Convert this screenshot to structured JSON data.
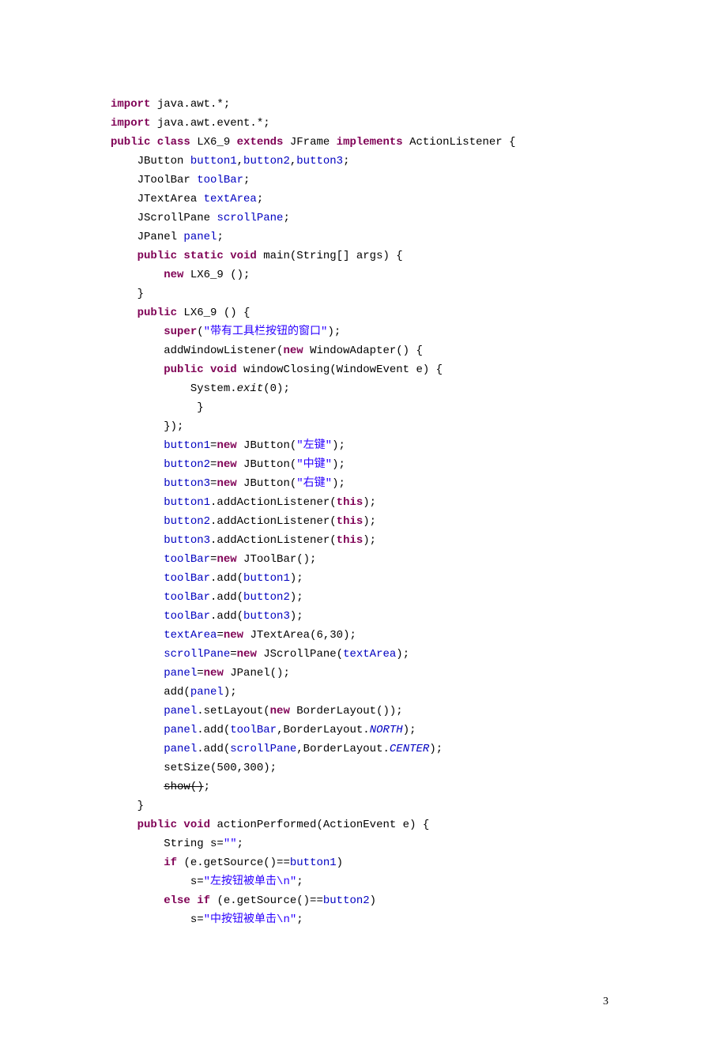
{
  "page_number": "3",
  "lines": [
    {
      "indent": 0,
      "tokens": [
        {
          "t": "import ",
          "c": "kw"
        },
        {
          "t": "java.awt.*;"
        }
      ]
    },
    {
      "indent": 0,
      "tokens": [
        {
          "t": "import ",
          "c": "kw"
        },
        {
          "t": "java.awt.event.*;"
        }
      ]
    },
    {
      "indent": 0,
      "tokens": [
        {
          "t": "public class ",
          "c": "kw"
        },
        {
          "t": "LX6_9 "
        },
        {
          "t": "extends ",
          "c": "kw"
        },
        {
          "t": "JFrame "
        },
        {
          "t": "implements ",
          "c": "kw"
        },
        {
          "t": "ActionListener {"
        }
      ]
    },
    {
      "indent": 1,
      "tokens": [
        {
          "t": "JButton "
        },
        {
          "t": "button1",
          "c": "fld"
        },
        {
          "t": ","
        },
        {
          "t": "button2",
          "c": "fld"
        },
        {
          "t": ","
        },
        {
          "t": "button3",
          "c": "fld"
        },
        {
          "t": ";"
        }
      ]
    },
    {
      "indent": 1,
      "tokens": [
        {
          "t": "JToolBar "
        },
        {
          "t": "toolBar",
          "c": "fld"
        },
        {
          "t": ";"
        }
      ]
    },
    {
      "indent": 1,
      "tokens": [
        {
          "t": "JTextArea "
        },
        {
          "t": "textArea",
          "c": "fld"
        },
        {
          "t": ";"
        }
      ]
    },
    {
      "indent": 1,
      "tokens": [
        {
          "t": "JScrollPane "
        },
        {
          "t": "scrollPane",
          "c": "fld"
        },
        {
          "t": ";"
        }
      ]
    },
    {
      "indent": 1,
      "tokens": [
        {
          "t": "JPanel "
        },
        {
          "t": "panel",
          "c": "fld"
        },
        {
          "t": ";"
        }
      ]
    },
    {
      "indent": 1,
      "tokens": [
        {
          "t": "public static void ",
          "c": "kw"
        },
        {
          "t": "main(String[] args) {"
        }
      ]
    },
    {
      "indent": 2,
      "tokens": [
        {
          "t": "new ",
          "c": "kw"
        },
        {
          "t": "LX6_9 ();"
        }
      ]
    },
    {
      "indent": 1,
      "tokens": [
        {
          "t": "}"
        }
      ]
    },
    {
      "indent": 1,
      "tokens": [
        {
          "t": "public ",
          "c": "kw"
        },
        {
          "t": "LX6_9 () {"
        }
      ]
    },
    {
      "indent": 2,
      "tokens": [
        {
          "t": "super",
          "c": "kw"
        },
        {
          "t": "("
        },
        {
          "t": "\"带有工具栏按钮的窗口\"",
          "c": "str"
        },
        {
          "t": ");"
        }
      ]
    },
    {
      "indent": 2,
      "tokens": [
        {
          "t": "addWindowListener("
        },
        {
          "t": "new ",
          "c": "kw"
        },
        {
          "t": "WindowAdapter() {"
        }
      ]
    },
    {
      "indent": 2,
      "tokens": [
        {
          "t": "public void ",
          "c": "kw"
        },
        {
          "t": "windowClosing(WindowEvent e) {"
        }
      ]
    },
    {
      "indent": 3,
      "tokens": [
        {
          "t": "System."
        },
        {
          "t": "exit",
          "c": "sta"
        },
        {
          "t": "(0);"
        }
      ]
    },
    {
      "indent": 3,
      "tokens": [
        {
          "t": " }"
        }
      ]
    },
    {
      "indent": 2,
      "tokens": [
        {
          "t": "});"
        }
      ]
    },
    {
      "indent": 2,
      "tokens": [
        {
          "t": "button1",
          "c": "fld"
        },
        {
          "t": "="
        },
        {
          "t": "new ",
          "c": "kw"
        },
        {
          "t": "JButton("
        },
        {
          "t": "\"左键\"",
          "c": "str"
        },
        {
          "t": ");"
        }
      ]
    },
    {
      "indent": 2,
      "tokens": [
        {
          "t": "button2",
          "c": "fld"
        },
        {
          "t": "="
        },
        {
          "t": "new ",
          "c": "kw"
        },
        {
          "t": "JButton("
        },
        {
          "t": "\"中键\"",
          "c": "str"
        },
        {
          "t": ");"
        }
      ]
    },
    {
      "indent": 2,
      "tokens": [
        {
          "t": "button3",
          "c": "fld"
        },
        {
          "t": "="
        },
        {
          "t": "new ",
          "c": "kw"
        },
        {
          "t": "JButton("
        },
        {
          "t": "\"右键\"",
          "c": "str"
        },
        {
          "t": ");"
        }
      ]
    },
    {
      "indent": 2,
      "tokens": [
        {
          "t": "button1",
          "c": "fld"
        },
        {
          "t": ".addActionListener("
        },
        {
          "t": "this",
          "c": "kw"
        },
        {
          "t": ");"
        }
      ]
    },
    {
      "indent": 2,
      "tokens": [
        {
          "t": "button2",
          "c": "fld"
        },
        {
          "t": ".addActionListener("
        },
        {
          "t": "this",
          "c": "kw"
        },
        {
          "t": ");"
        }
      ]
    },
    {
      "indent": 2,
      "tokens": [
        {
          "t": "button3",
          "c": "fld"
        },
        {
          "t": ".addActionListener("
        },
        {
          "t": "this",
          "c": "kw"
        },
        {
          "t": ");"
        }
      ]
    },
    {
      "indent": 2,
      "tokens": [
        {
          "t": "toolBar",
          "c": "fld"
        },
        {
          "t": "="
        },
        {
          "t": "new ",
          "c": "kw"
        },
        {
          "t": "JToolBar();"
        }
      ]
    },
    {
      "indent": 2,
      "tokens": [
        {
          "t": "toolBar",
          "c": "fld"
        },
        {
          "t": ".add("
        },
        {
          "t": "button1",
          "c": "fld"
        },
        {
          "t": ");"
        }
      ]
    },
    {
      "indent": 2,
      "tokens": [
        {
          "t": "toolBar",
          "c": "fld"
        },
        {
          "t": ".add("
        },
        {
          "t": "button2",
          "c": "fld"
        },
        {
          "t": ");"
        }
      ]
    },
    {
      "indent": 2,
      "tokens": [
        {
          "t": "toolBar",
          "c": "fld"
        },
        {
          "t": ".add("
        },
        {
          "t": "button3",
          "c": "fld"
        },
        {
          "t": ");"
        }
      ]
    },
    {
      "indent": 2,
      "tokens": [
        {
          "t": "textArea",
          "c": "fld"
        },
        {
          "t": "="
        },
        {
          "t": "new ",
          "c": "kw"
        },
        {
          "t": "JTextArea(6,30);"
        }
      ]
    },
    {
      "indent": 2,
      "tokens": [
        {
          "t": "scrollPane",
          "c": "fld"
        },
        {
          "t": "="
        },
        {
          "t": "new ",
          "c": "kw"
        },
        {
          "t": "JScrollPane("
        },
        {
          "t": "textArea",
          "c": "fld"
        },
        {
          "t": ");"
        }
      ]
    },
    {
      "indent": 2,
      "tokens": [
        {
          "t": "panel",
          "c": "fld"
        },
        {
          "t": "="
        },
        {
          "t": "new ",
          "c": "kw"
        },
        {
          "t": "JPanel();"
        }
      ]
    },
    {
      "indent": 2,
      "tokens": [
        {
          "t": "add("
        },
        {
          "t": "panel",
          "c": "fld"
        },
        {
          "t": ");"
        }
      ]
    },
    {
      "indent": 2,
      "tokens": [
        {
          "t": "panel",
          "c": "fld"
        },
        {
          "t": ".setLayout("
        },
        {
          "t": "new ",
          "c": "kw"
        },
        {
          "t": "BorderLayout());"
        }
      ]
    },
    {
      "indent": 2,
      "tokens": [
        {
          "t": "panel",
          "c": "fld"
        },
        {
          "t": ".add("
        },
        {
          "t": "toolBar",
          "c": "fld"
        },
        {
          "t": ",BorderLayout."
        },
        {
          "t": "NORTH",
          "c": "fld sta"
        },
        {
          "t": ");"
        }
      ]
    },
    {
      "indent": 2,
      "tokens": [
        {
          "t": "panel",
          "c": "fld"
        },
        {
          "t": ".add("
        },
        {
          "t": "scrollPane",
          "c": "fld"
        },
        {
          "t": ",BorderLayout."
        },
        {
          "t": "CENTER",
          "c": "fld sta"
        },
        {
          "t": ");"
        }
      ]
    },
    {
      "indent": 2,
      "tokens": [
        {
          "t": "setSize(500,300);"
        }
      ]
    },
    {
      "indent": 2,
      "tokens": [
        {
          "t": "show()",
          "c": "strike"
        },
        {
          "t": ";"
        }
      ]
    },
    {
      "indent": 1,
      "tokens": [
        {
          "t": "}"
        }
      ]
    },
    {
      "indent": 1,
      "tokens": [
        {
          "t": "public void ",
          "c": "kw"
        },
        {
          "t": "actionPerformed(ActionEvent e) {"
        }
      ]
    },
    {
      "indent": 2,
      "tokens": [
        {
          "t": "String s="
        },
        {
          "t": "\"\"",
          "c": "str"
        },
        {
          "t": ";"
        }
      ]
    },
    {
      "indent": 2,
      "tokens": [
        {
          "t": "if ",
          "c": "kw"
        },
        {
          "t": "(e.getSource()=="
        },
        {
          "t": "button1",
          "c": "fld"
        },
        {
          "t": ")"
        }
      ]
    },
    {
      "indent": 3,
      "tokens": [
        {
          "t": "s="
        },
        {
          "t": "\"左按钮被单击\\n\"",
          "c": "str"
        },
        {
          "t": ";"
        }
      ]
    },
    {
      "indent": 2,
      "tokens": [
        {
          "t": "else if ",
          "c": "kw"
        },
        {
          "t": "(e.getSource()=="
        },
        {
          "t": "button2",
          "c": "fld"
        },
        {
          "t": ")"
        }
      ]
    },
    {
      "indent": 3,
      "tokens": [
        {
          "t": "s="
        },
        {
          "t": "\"中按钮被单击\\n\"",
          "c": "str"
        },
        {
          "t": ";"
        }
      ]
    }
  ]
}
